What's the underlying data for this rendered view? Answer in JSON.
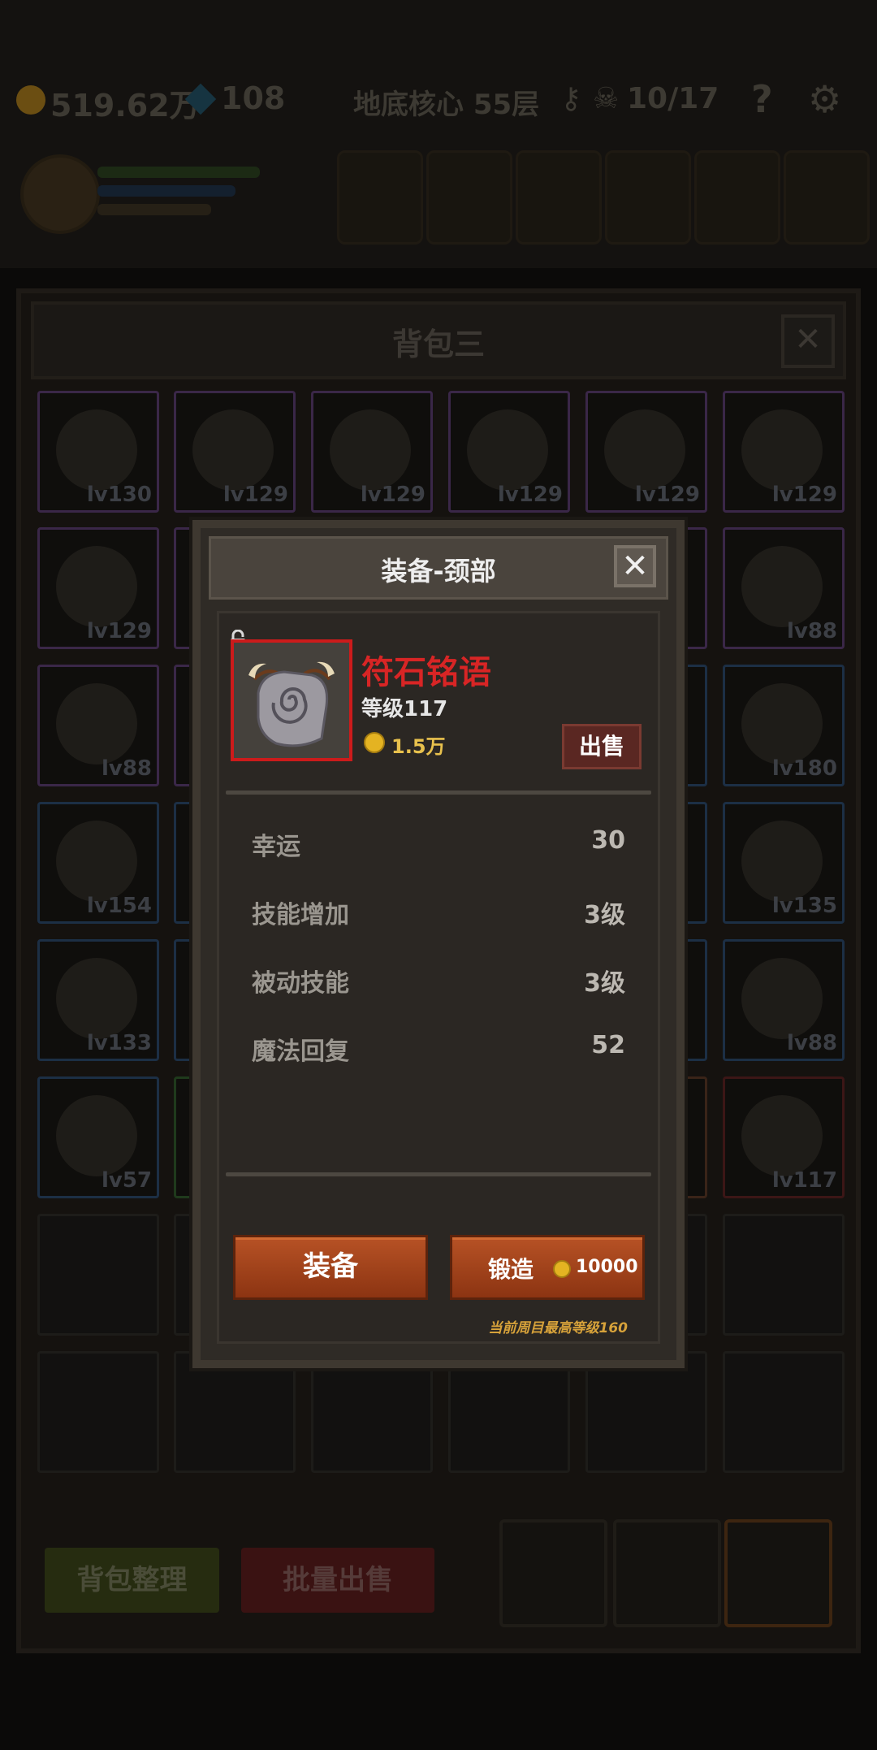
{
  "hud": {
    "gold": "519.62万",
    "gems": "108",
    "floor": "地底核心 55层",
    "kills": "10/17",
    "help": "?"
  },
  "inventory": {
    "title": "背包三",
    "close": "✕",
    "levels": [
      [
        "lv130",
        "lv129",
        "lv129",
        "lv129",
        "lv129",
        "lv129"
      ],
      [
        "lv129",
        "",
        "",
        "",
        "",
        "lv88"
      ],
      [
        "lv88",
        "",
        "",
        "",
        "",
        "lv180"
      ],
      [
        "lv154",
        "",
        "",
        "",
        "",
        "lv135"
      ],
      [
        "lv133",
        "",
        "",
        "",
        "",
        "lv88"
      ],
      [
        "lv57",
        "",
        "",
        "",
        "",
        "lv117"
      ]
    ],
    "sort_button": "背包整理",
    "bulk_sell_button": "批量出售"
  },
  "dialog": {
    "title": "装备-颈部",
    "close": "✕",
    "item_name": "符石铭语",
    "item_level": "等级117",
    "price": "1.5万",
    "sell_button": "出售",
    "stats": [
      {
        "name": "幸运",
        "value": "30"
      },
      {
        "name": "技能增加",
        "value": "3级"
      },
      {
        "name": "被动技能",
        "value": "3级"
      },
      {
        "name": "魔法回复",
        "value": "52"
      }
    ],
    "equip_button": "装备",
    "forge_button": "锻造",
    "forge_cost": "10000",
    "note": "当前周目最高等级160"
  },
  "colors": {
    "item_name": "#d82525",
    "price": "#e8c14d",
    "button": "#a44420"
  }
}
